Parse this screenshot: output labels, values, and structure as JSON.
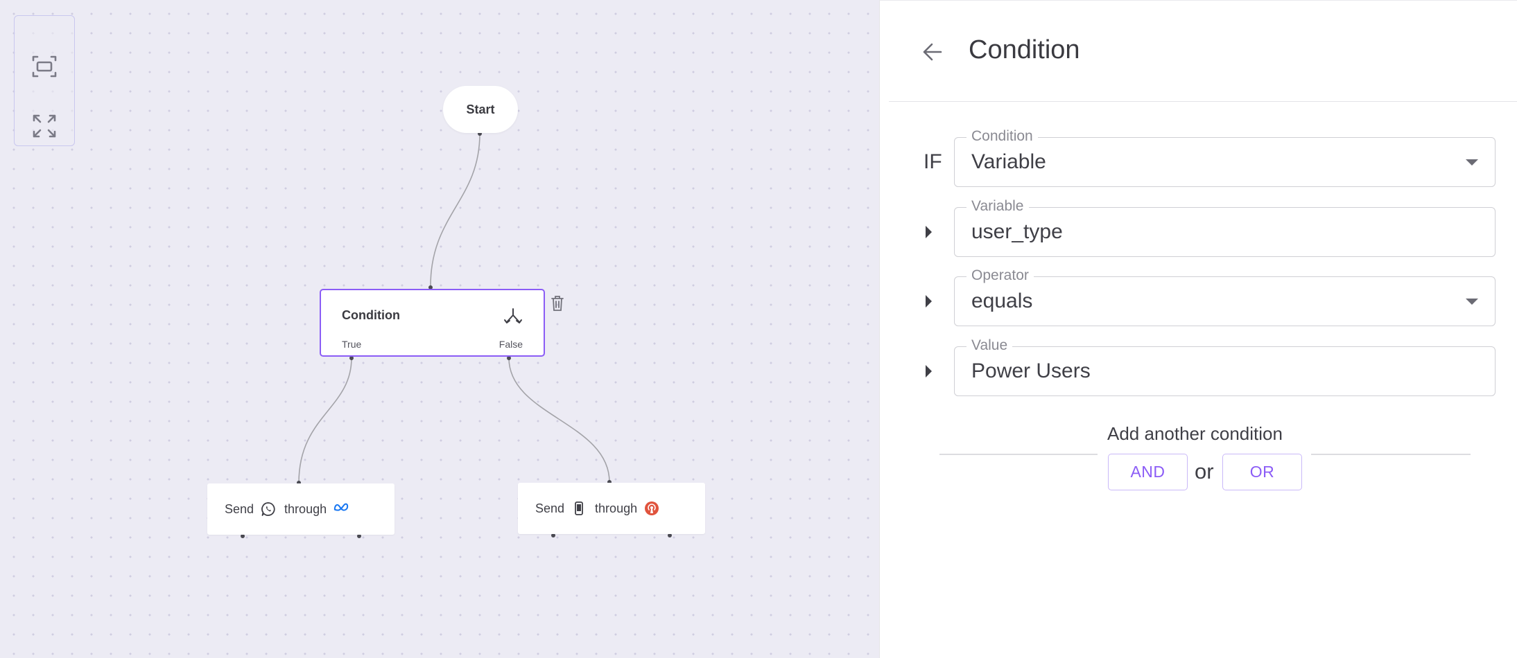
{
  "canvas": {
    "start_node": {
      "label": "Start"
    },
    "condition_node": {
      "title": "Condition",
      "true_label": "True",
      "false_label": "False",
      "icon": "branch-icon"
    },
    "send_nodes": [
      {
        "send_label": "Send",
        "through_label": "through",
        "channel_icon": "whatsapp-icon",
        "provider_icon": "meta-icon"
      },
      {
        "send_label": "Send",
        "through_label": "through",
        "channel_icon": "mobile-phone-icon",
        "provider_icon": "broadcast-icon"
      }
    ],
    "zoom_controls": [
      "fit-view-icon",
      "fullscreen-icon"
    ]
  },
  "panel": {
    "title": "Condition",
    "if_label": "IF",
    "fields": {
      "condition": {
        "legend": "Condition",
        "value": "Variable"
      },
      "variable": {
        "legend": "Variable",
        "value": "user_type"
      },
      "operator": {
        "legend": "Operator",
        "value": "equals"
      },
      "value": {
        "legend": "Value",
        "value": "Power Users"
      }
    },
    "add_condition_label": "Add another condition",
    "and_label": "AND",
    "or_separator": "or",
    "or_label": "OR"
  },
  "colors": {
    "accent": "#8b5cf6",
    "canvas_bg": "#ecebf4",
    "whatsapp": "#3f3f46",
    "meta": "#1877f2",
    "broadcast": "#e0533d"
  }
}
